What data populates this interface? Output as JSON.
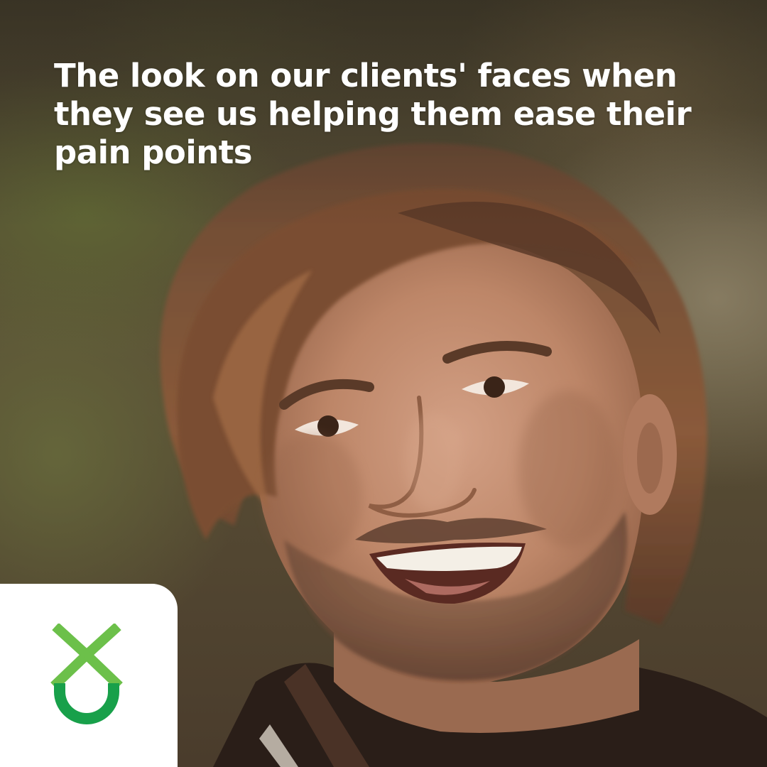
{
  "post": {
    "caption": "The look on our clients' faces when they see us helping them ease their pain points"
  },
  "brand": {
    "logo_icon": "green-chevron-ring-logo-icon",
    "colors": {
      "light_green": "#6cc04a",
      "dark_green": "#18a04a",
      "card": "#ffffff",
      "caption_text": "#ffffff"
    }
  },
  "photo": {
    "subject": "smiling-man-photo"
  }
}
